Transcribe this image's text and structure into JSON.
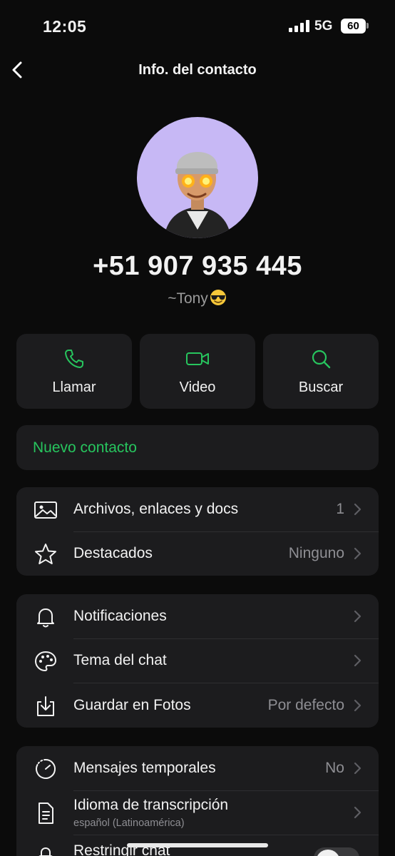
{
  "status_bar": {
    "time": "12:05",
    "network": "5G",
    "battery": "60"
  },
  "nav": {
    "title": "Info. del contacto",
    "back_icon": "chevron-left-icon"
  },
  "contact": {
    "phone": "+51 907 935 445",
    "nickname": "~Tony",
    "nickname_emoji": "sunglasses-emoji"
  },
  "actions": [
    {
      "label": "Llamar",
      "icon": "phone-icon"
    },
    {
      "label": "Video",
      "icon": "video-icon"
    },
    {
      "label": "Buscar",
      "icon": "search-icon"
    }
  ],
  "new_contact": {
    "label": "Nuevo contacto"
  },
  "media_group": [
    {
      "label": "Archivos, enlaces y docs",
      "value": "1",
      "icon": "image-icon"
    },
    {
      "label": "Destacados",
      "value": "Ninguno",
      "icon": "star-icon"
    }
  ],
  "settings_group": [
    {
      "label": "Notificaciones",
      "value": "",
      "icon": "bell-icon"
    },
    {
      "label": "Tema del chat",
      "value": "",
      "icon": "palette-icon"
    },
    {
      "label": "Guardar en Fotos",
      "value": "Por defecto",
      "icon": "download-icon"
    }
  ],
  "privacy_group": [
    {
      "label": "Mensajes temporales",
      "value": "No",
      "icon": "timer-icon"
    },
    {
      "label": "Idioma de transcripción",
      "sublabel": "español (Latinoamérica)",
      "value": "",
      "icon": "document-icon"
    },
    {
      "label": "Restringir chat",
      "icon": "lock-icon",
      "toggle": false
    }
  ],
  "colors": {
    "accent": "#27c55e",
    "card": "#1c1c1e",
    "background": "#0b0b0b",
    "avatar_bg": "#c7b8f5"
  }
}
